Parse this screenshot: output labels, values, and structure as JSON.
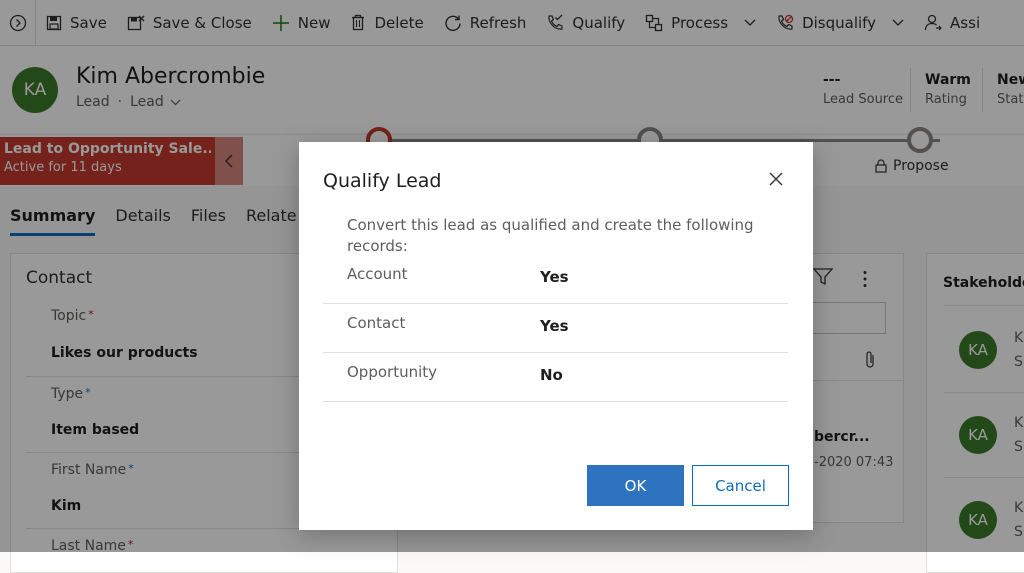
{
  "commandbar": {
    "save": "Save",
    "save_close": "Save & Close",
    "new": "New",
    "delete": "Delete",
    "refresh": "Refresh",
    "qualify": "Qualify",
    "process": "Process",
    "disqualify": "Disqualify",
    "assign": "Assi"
  },
  "record": {
    "initials": "KA",
    "name": "Kim Abercrombie",
    "entity": "Lead",
    "form": "Lead",
    "header_fields": [
      {
        "value": "---",
        "label": "Lead Source"
      },
      {
        "value": "Warm",
        "label": "Rating"
      },
      {
        "value": "New",
        "label": "Statu"
      }
    ]
  },
  "bpf": {
    "active_stage": "Lead to Opportunity Sale...",
    "active_duration": "Active for 11 days",
    "locked_stage": "Propose"
  },
  "tabs": [
    "Summary",
    "Details",
    "Files",
    "Relate"
  ],
  "contact": {
    "title": "Contact",
    "fields": [
      {
        "label": "Topic",
        "value": "Likes our products"
      },
      {
        "label": "Type",
        "value": "Item based"
      },
      {
        "label": "First Name",
        "value": "Kim"
      },
      {
        "label": "Last Name",
        "value": ""
      }
    ]
  },
  "timeline": {
    "entry_title": "bercr...",
    "entry_date": "-2020 07:43"
  },
  "stakeholders": {
    "title": "Stakeholde",
    "items": [
      {
        "initials": "KA",
        "line1": "K",
        "line2": "S"
      },
      {
        "initials": "KA",
        "line1": "K",
        "line2": "S"
      },
      {
        "initials": "KA",
        "line1": "K",
        "line2": "S"
      }
    ]
  },
  "dialog": {
    "title": "Qualify Lead",
    "description": "Convert this lead as qualified and create the following records:",
    "rows": [
      {
        "label": "Account",
        "value": "Yes"
      },
      {
        "label": "Contact",
        "value": "Yes"
      },
      {
        "label": "Opportunity",
        "value": "No"
      }
    ],
    "ok": "OK",
    "cancel": "Cancel"
  },
  "colors": {
    "primary": "#2e73bd",
    "avatar": "#3b7a2b",
    "stage_active": "#c23a2d"
  }
}
